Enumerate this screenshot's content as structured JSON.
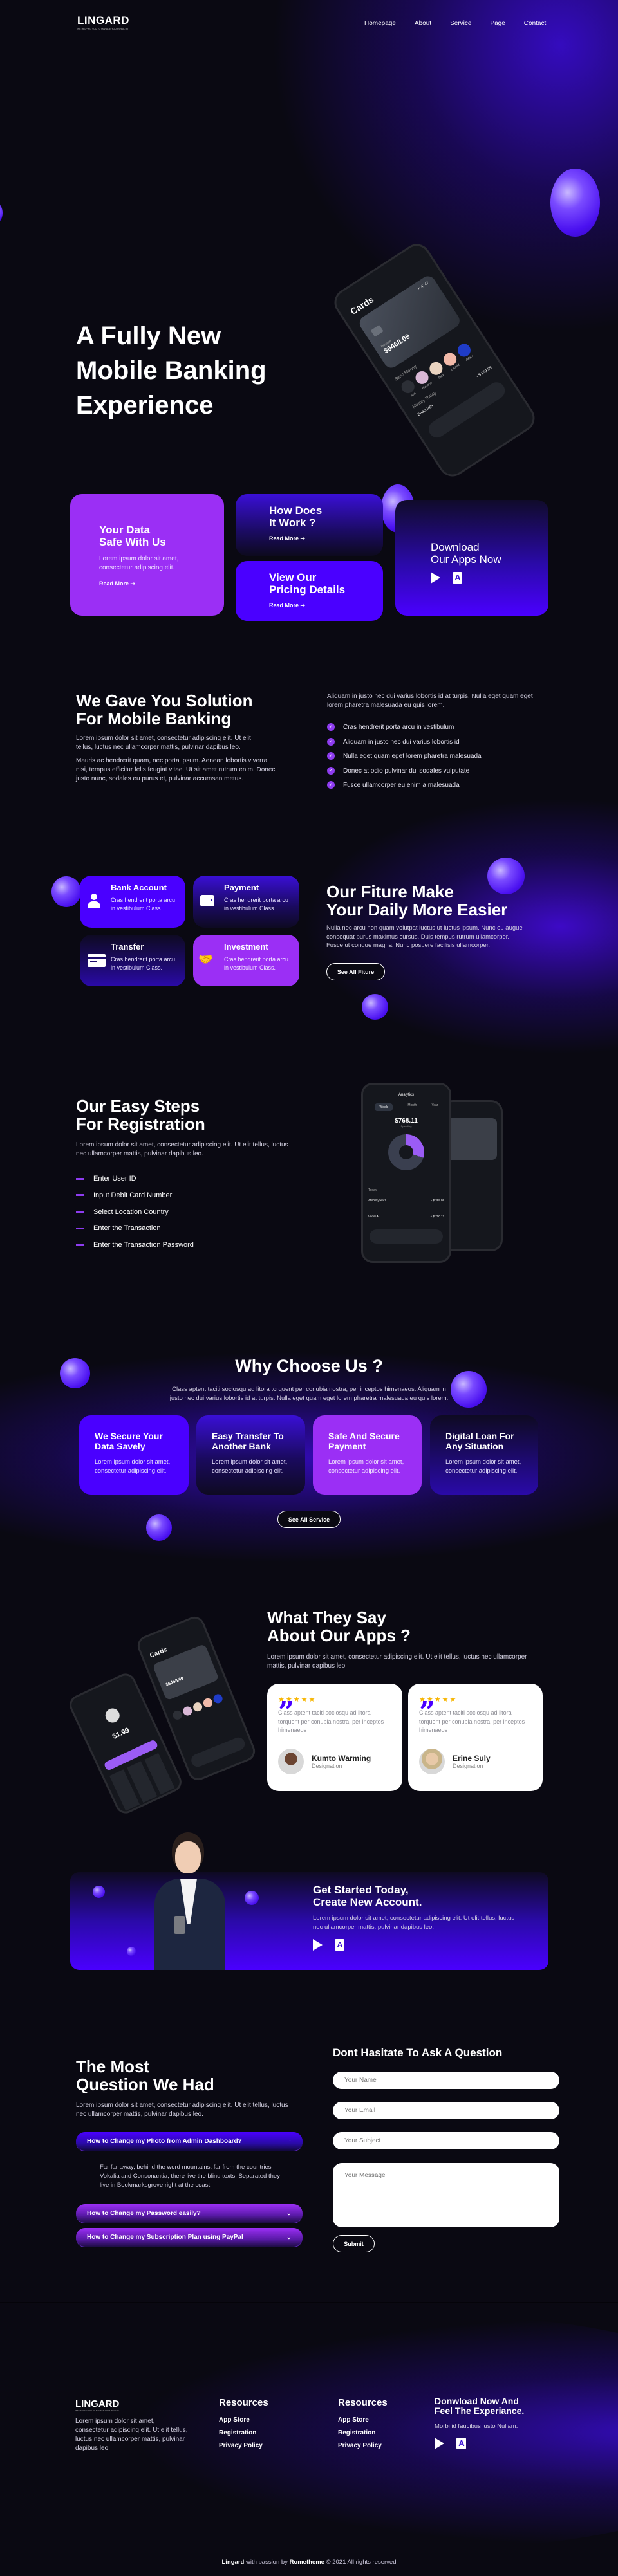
{
  "nav": {
    "logo": "LINGARD",
    "tagline": "WE HELPING YOU TO MANAGE YOUR WEALTH",
    "items": [
      "Homepage",
      "About",
      "Service",
      "Page",
      "Contact"
    ]
  },
  "hero": {
    "title_lines": [
      "A Fully New",
      "Mobile Banking",
      "Experience"
    ],
    "phone": {
      "screen_title": "Cards",
      "balance_label": "Balance",
      "balance": "$6468.09",
      "card_last": "•• 4747",
      "send_money": "Send Money",
      "contacts": [
        "Add",
        "Eugene",
        "Alex",
        "Leonid",
        "Valery"
      ],
      "history": "History Today",
      "history_item": "Beats Pill+",
      "history_amount": "- $ 179.95"
    }
  },
  "promo_cards": [
    {
      "title_lines": [
        "Your Data",
        "Safe With Us"
      ],
      "text": "Lorem ipsum dolor sit amet, consectetur adipiscing elit.",
      "link": "Read More ➞"
    },
    {
      "title_lines": [
        "How Does",
        "It Work ?"
      ],
      "link": "Read More ➞"
    },
    {
      "title_lines": [
        "View Our",
        "Pricing Details"
      ],
      "link": "Read More ➞"
    },
    {
      "title_lines": [
        "Download",
        "Our Apps Now"
      ],
      "icons": [
        "play-store-icon",
        "app-store-icon"
      ]
    }
  ],
  "solution": {
    "title_lines": [
      "We Gave You Solution",
      "For Mobile Banking"
    ],
    "para1": "Lorem ipsum dolor sit amet, consectetur adipiscing elit. Ut elit tellus, luctus nec ullamcorper mattis, pulvinar dapibus leo.",
    "para2": "Mauris ac hendrerit quam, nec porta ipsum. Aenean lobortis viverra nisi, tempus efficitur felis feugiat vitae. Ut sit amet rutrum enim. Donec justo nunc, sodales eu purus et, pulvinar accumsan metus.",
    "right_para": "Aliquam in justo nec dui varius lobortis id at turpis. Nulla eget quam eget lorem pharetra malesuada eu quis lorem.",
    "checklist": [
      "Cras hendrerit porta arcu in vestibulum",
      "Aliquam in justo nec dui varius lobortis id",
      "Nulla eget quam eget lorem pharetra malesuada",
      "Donec at odio pulvinar dui sodales vulputate",
      "Fusce ullamcorper eu enim a malesuada"
    ]
  },
  "features": {
    "items": [
      {
        "title": "Bank Account",
        "text": "Cras hendrerit porta arcu in vestibulum Class.",
        "icon": "user-icon"
      },
      {
        "title": "Payment",
        "text": "Cras hendrerit porta arcu in vestibulum Class.",
        "icon": "wallet-icon"
      },
      {
        "title": "Transfer",
        "text": "Cras hendrerit porta arcu in vestibulum Class.",
        "icon": "card-icon"
      },
      {
        "title": "Investment",
        "text": "Cras hendrerit porta arcu in vestibulum Class.",
        "icon": "handshake-icon"
      }
    ],
    "title_lines": [
      "Our Fiture Make",
      "Your Daily More Easier"
    ],
    "text": "Nulla nec arcu non quam volutpat luctus ut luctus ipsum. Nunc eu augue consequat purus maximus cursus. Duis tempus rutrum ullamcorper. Fusce ut congue magna. Nunc posuere facilisis ullamcorper.",
    "button": "See All Fiture"
  },
  "steps": {
    "title_lines": [
      "Our Easy Steps",
      "For Registration"
    ],
    "text": "Lorem ipsum dolor sit amet, consectetur adipiscing elit. Ut elit tellus, luctus nec ullamcorper mattis, pulvinar dapibus leo.",
    "items": [
      "Enter User ID",
      "Input Debit Card Number",
      "Select Location Country",
      "Enter the Transaction",
      "Enter the Transaction Password"
    ],
    "phone": {
      "screen_title": "Analytics",
      "tabs": [
        "Week",
        "Month",
        "Year"
      ],
      "amount": "$768.11",
      "spending": "Spending",
      "today": "Today",
      "rows": [
        {
          "name": "AMD Ryzen 7",
          "amount": "- $ 399.99"
        },
        {
          "name": "Vadim M.",
          "amount": "+ $ 700.12"
        }
      ]
    }
  },
  "why": {
    "title": "Why Choose Us ?",
    "text": "Class aptent taciti sociosqu ad litora torquent per conubia nostra, per inceptos himenaeos. Aliquam in justo nec dui varius lobortis id at turpis. Nulla eget quam eget lorem pharetra malesuada eu quis lorem.",
    "cards": [
      {
        "title_lines": [
          "We Secure Your",
          "Data Savely"
        ],
        "text": "Lorem ipsum dolor sit amet, consectetur adipiscing elit."
      },
      {
        "title_lines": [
          "Easy Transfer To",
          "Another Bank"
        ],
        "text": "Lorem ipsum dolor sit amet, consectetur adipiscing elit."
      },
      {
        "title_lines": [
          "Safe And Secure",
          "Payment"
        ],
        "text": "Lorem ipsum dolor sit amet, consectetur adipiscing elit."
      },
      {
        "title_lines": [
          "Digital Loan For",
          "Any Situation"
        ],
        "text": "Lorem ipsum dolor sit amet, consectetur adipiscing elit."
      }
    ],
    "button": "See All Service"
  },
  "testimonials": {
    "title_lines": [
      "What They Say",
      "About Our Apps ?"
    ],
    "text": "Lorem ipsum dolor sit amet, consectetur adipiscing elit. Ut elit tellus, luctus nec ullamcorper mattis, pulvinar dapibus leo.",
    "items": [
      {
        "rating": 5,
        "quote": "Class aptent taciti sociosqu ad litora torquent per conubia nostra, per inceptos himenaeos",
        "name": "Kumto Warming",
        "role": "Designation"
      },
      {
        "rating": 5,
        "quote": "Class aptent taciti sociosqu ad litora torquent per conubia nostra, per inceptos himenaeos",
        "name": "Erine Suly",
        "role": "Designation"
      }
    ],
    "phone_amount": "$1.99",
    "phone_title": "Cards",
    "phone_balance": "$6468.09"
  },
  "cta": {
    "title_lines": [
      "Get Started Today,",
      "Create New Account."
    ],
    "text": "Lorem ipsum dolor sit amet, consectetur adipiscing elit. Ut elit tellus, luctus nec ullamcorper mattis, pulvinar dapibus leo."
  },
  "faq": {
    "title_lines": [
      "The Most",
      "Question We Had"
    ],
    "text": "Lorem ipsum dolor sit amet, consectetur adipiscing elit. Ut elit tellus, luctus nec ullamcorper mattis, pulvinar dapibus leo.",
    "items": [
      {
        "q": "How to Change my Photo from Admin Dashboard?",
        "a": "Far far away, behind the word mountains, far from the countries Vokalia and Consonantia, there live the blind texts. Separated they live in Bookmarksgrove right at the coast",
        "open": true
      },
      {
        "q": "How to Change my Password easily?",
        "open": false
      },
      {
        "q": "How to Change my Subscription Plan using PayPal",
        "open": false
      }
    ]
  },
  "contact": {
    "title": "Dont Hasitate To Ask A Question",
    "name_placeholder": "Your Name",
    "email_placeholder": "Your Email",
    "subject_placeholder": "Your Subject",
    "message_placeholder": "Your Message",
    "submit": "Submit"
  },
  "footer": {
    "logo": "LINGARD",
    "tagline": "WE HELPING YOU TO MANAGE YOUR WEALTH",
    "text": "Lorem ipsum dolor sit amet, consectetur adipiscing elit. Ut elit tellus, luctus nec ullamcorper mattis, pulvinar dapibus leo.",
    "columns": [
      {
        "title": "Resources",
        "links": [
          "App Store",
          "Registration",
          "Privacy Policy"
        ]
      },
      {
        "title": "Resources",
        "links": [
          "App Store",
          "Registration",
          "Privacy Policy"
        ]
      }
    ],
    "download_title_lines": [
      "Donwload Now And",
      "Feel The Experiance."
    ],
    "download_text": "Morbi id faucibus justo Nullam.",
    "copyright": {
      "brand": "Lingard",
      "mid": " with passion by ",
      "author": "Rometheme",
      "rest": " © 2021 All rights reserved"
    }
  },
  "colors": {
    "background": "#0a0912",
    "purple": "#9b2ff5",
    "blue": "#4a00ff",
    "dark_blue": "#2a0aa8",
    "star": "#f7b500"
  }
}
